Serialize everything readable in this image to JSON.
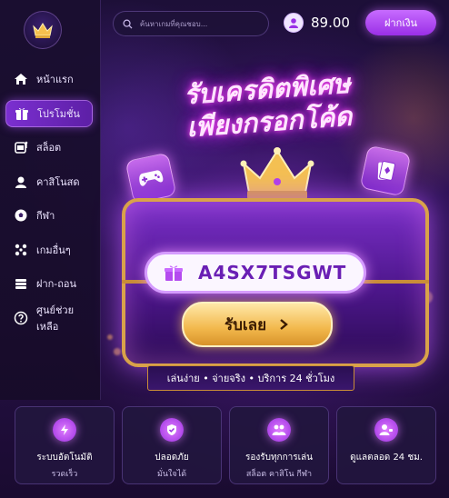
{
  "top_bar": {
    "search_placeholder": "ค้นหาเกมที่คุณชอบ...",
    "balance": "89.00",
    "deposit_label": "ฝากเงิน"
  },
  "sidebar": {
    "items": [
      {
        "label": "หน้าแรก",
        "icon": "home-icon"
      },
      {
        "label": "โปรโมชั่น",
        "icon": "gift-icon"
      },
      {
        "label": "สล็อต",
        "icon": "slot-icon"
      },
      {
        "label": "คาสิโนสด",
        "icon": "casino-icon"
      },
      {
        "label": "กีฬา",
        "icon": "ball-icon"
      },
      {
        "label": "เกมอื่นๆ",
        "icon": "grid-icon"
      },
      {
        "label": "ฝาก-ถอน",
        "icon": "wallet-icon"
      },
      {
        "label": "ศูนย์ช่วยเหลือ",
        "icon": "help-icon"
      }
    ],
    "active_index": 1
  },
  "hero": {
    "headline_line1": "รับเครดิตพิเศษ",
    "headline_line2": "เพียงกรอกโค้ด",
    "promo_code": "A4SX7TSGWT",
    "claim_label": "รับเลย",
    "tagline": "เล่นง่าย • จ่ายจริง • บริการ 24 ชั่วโมง"
  },
  "features": [
    {
      "title": "ระบบอัตโนมัติ",
      "subtitle": "รวดเร็ว",
      "icon": "lightning-icon"
    },
    {
      "title": "ปลอดภัย",
      "subtitle": "มั่นใจได้",
      "icon": "shield-icon"
    },
    {
      "title": "รองรับทุกการเล่น",
      "subtitle": "สล็อต คาสิโน กีฬา",
      "icon": "users-icon"
    },
    {
      "title": "ดูแลตลอด 24 ชม.",
      "subtitle": "",
      "icon": "support-icon"
    }
  ],
  "colors": {
    "accent": "#9a2fe6",
    "gold": "#f2b84c",
    "background": "#140a24"
  }
}
